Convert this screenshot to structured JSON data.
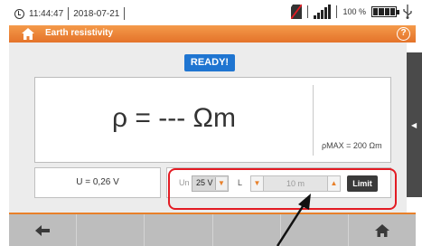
{
  "status": {
    "time": "11:44:47",
    "date": "2018-07-21",
    "battery": "100 %"
  },
  "header": {
    "title": "Earth resistivity",
    "help": "?"
  },
  "main": {
    "status_badge": "READY!",
    "result": "ρ = --- Ωm",
    "rho_max": "ρMAX = 200 Ωm",
    "voltage": "U = 0,26 V"
  },
  "params": {
    "un_label": "Un",
    "un_value": "25 V",
    "l_label": "L",
    "l_value": "10 m",
    "limit_label": "Limit"
  },
  "icons": {
    "clock": "clock-icon",
    "sd_card": "sd-card-icon",
    "signal": "signal-icon",
    "battery": "battery-icon",
    "usb": "usb-icon",
    "home": "home-icon",
    "help": "help-icon",
    "back": "back-arrow-icon",
    "side": "chevron-left-icon"
  },
  "colors": {
    "accent": "#e8802a",
    "ready": "#1f75d1",
    "highlight": "#e31b23"
  }
}
